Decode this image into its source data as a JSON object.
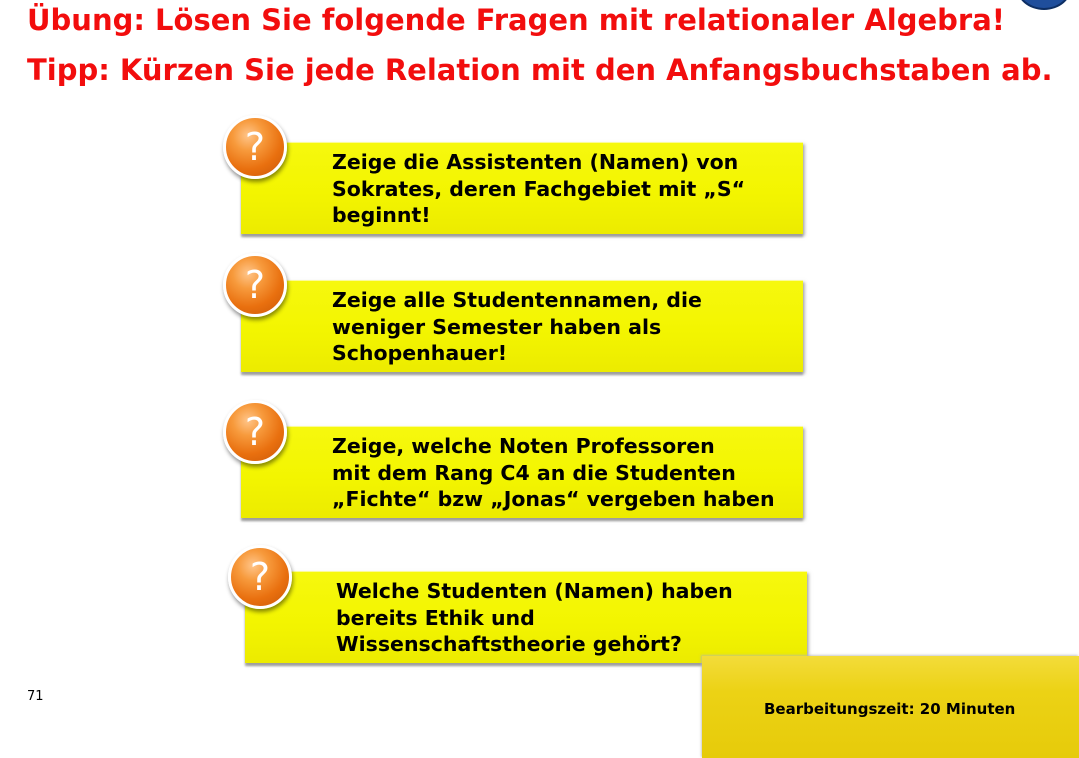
{
  "title": {
    "line1": "Übung: Lösen Sie folgende Fragen mit relationaler Algebra!",
    "line2": "Tipp: Kürzen Sie jede Relation mit den Anfangsbuchstaben ab."
  },
  "badge_symbol": "?",
  "questions": [
    {
      "text": "Zeige die Assistenten (Namen) von\nSokrates, deren Fachgebiet mit „S“\nbeginnt!"
    },
    {
      "text": "Zeige alle Studentennamen, die\nweniger Semester haben als\nSchopenhauer!"
    },
    {
      "text": "Zeige, welche Noten Professoren\nmit  dem Rang C4 an die Studenten\n„Fichte“ bzw „Jonas“ vergeben haben"
    },
    {
      "text": "Welche Studenten (Namen) haben\nbereits Ethik und\nWissenschaftstheorie gehört?"
    }
  ],
  "page_number": "71",
  "time_box": {
    "label": "Bearbeitungszeit: 20 Minuten"
  },
  "colors": {
    "title": "#f20d0d",
    "card": "#f3f500",
    "badge": "#e9700f",
    "time_box": "#ecd215"
  },
  "icons": {
    "badge": "question-mark-icon",
    "corner": "logo-icon"
  }
}
